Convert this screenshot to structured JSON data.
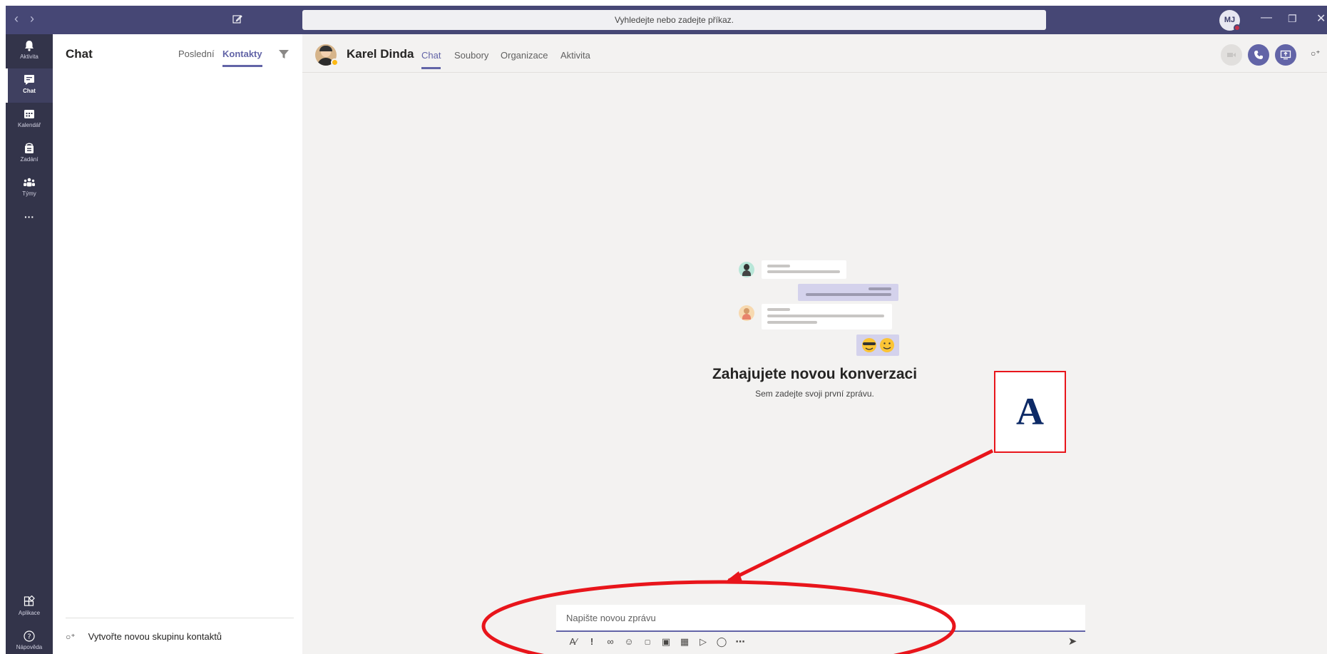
{
  "titlebar": {
    "search_placeholder": "Vyhledejte nebo zadejte příkaz.",
    "user_initials": "MJ",
    "window_controls": [
      "—",
      "❐",
      "✕"
    ]
  },
  "rail": {
    "items": [
      {
        "label": "Aktivita",
        "icon": "bell-icon"
      },
      {
        "label": "Chat",
        "icon": "chat-icon",
        "active": true
      },
      {
        "label": "Kalendář",
        "icon": "calendar-icon"
      },
      {
        "label": "Zadání",
        "icon": "assignments-icon"
      },
      {
        "label": "Týmy",
        "icon": "teams-icon"
      },
      {
        "label": "···",
        "icon": "more-icon"
      }
    ],
    "bottom": [
      {
        "label": "Aplikace",
        "icon": "apps-icon"
      },
      {
        "label": "Nápověda",
        "icon": "help-icon"
      }
    ]
  },
  "list": {
    "title": "Chat",
    "tabs": [
      "Poslední",
      "Kontakty"
    ],
    "active_tab": "Kontakty",
    "new_group": "Vytvořte novou skupinu kontaktů"
  },
  "main": {
    "contact_name": "Karel Dinda",
    "tabs": [
      "Chat",
      "Soubory",
      "Organizace",
      "Aktivita"
    ],
    "active_tab": "Chat",
    "empty_title": "Zahajujete novou konverzaci",
    "empty_subtitle": "Sem zadejte svoji první zprávu.",
    "compose_placeholder": "Napište novou zprávu"
  },
  "annotation": {
    "label": "A",
    "color": "#e8151b"
  },
  "colors": {
    "accent": "#6264a7",
    "titlebar": "#464775",
    "rail": "#33344a",
    "status_away": "#fdb913"
  }
}
